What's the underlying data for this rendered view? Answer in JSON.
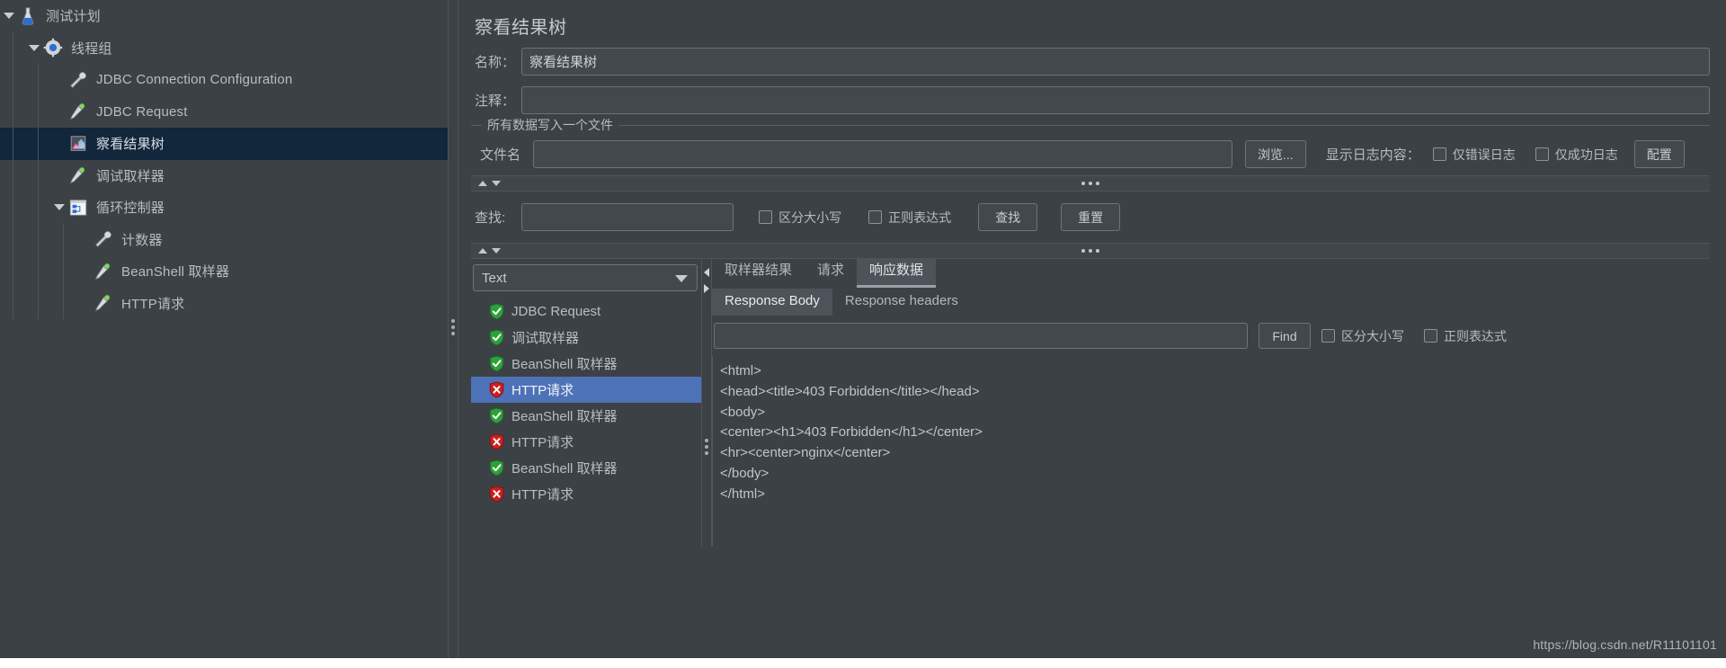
{
  "tree": {
    "items": [
      {
        "label": "测试计划",
        "icon": "flask-icon",
        "depth": 0,
        "twisty": "down",
        "selected": false
      },
      {
        "label": "线程组",
        "icon": "gear-icon",
        "depth": 1,
        "twisty": "down",
        "selected": false
      },
      {
        "label": "JDBC Connection Configuration",
        "icon": "tools-icon",
        "depth": 2,
        "twisty": "none",
        "selected": false
      },
      {
        "label": "JDBC Request",
        "icon": "pipette-icon",
        "depth": 2,
        "twisty": "none",
        "selected": false
      },
      {
        "label": "察看结果树",
        "icon": "chart-icon",
        "depth": 2,
        "twisty": "none",
        "selected": true
      },
      {
        "label": "调试取样器",
        "icon": "pipette-icon",
        "depth": 2,
        "twisty": "none",
        "selected": false
      },
      {
        "label": "循环控制器",
        "icon": "controller-icon",
        "depth": 2,
        "twisty": "down",
        "selected": false
      },
      {
        "label": "计数器",
        "icon": "tools-icon",
        "depth": 3,
        "twisty": "none",
        "selected": false
      },
      {
        "label": "BeanShell 取样器",
        "icon": "pipette-icon",
        "depth": 3,
        "twisty": "none",
        "selected": false
      },
      {
        "label": "HTTP请求",
        "icon": "pipette-icon",
        "depth": 3,
        "twisty": "none",
        "selected": false
      }
    ]
  },
  "panel": {
    "title": "察看结果树",
    "name_label": "名称：",
    "name_value": "察看结果树",
    "comment_label": "注释：",
    "comment_value": "",
    "comment_placeholder": "",
    "group_legend": "所有数据写入一个文件",
    "filename_label": "文件名",
    "filename_value": "",
    "browse_button": "浏览...",
    "log_display_label": "显示日志内容：",
    "errors_only": "仅错误日志",
    "success_only": "仅成功日志",
    "configure_button": "配置"
  },
  "search": {
    "label": "查找:",
    "value": "",
    "case_sensitive": "区分大小写",
    "regex": "正则表达式",
    "find_button": "查找",
    "reset_button": "重置"
  },
  "results": {
    "renderer_selected": "Text",
    "rows": [
      {
        "label": "JDBC Request",
        "status": "success",
        "selected": false
      },
      {
        "label": "调试取样器",
        "status": "success",
        "selected": false
      },
      {
        "label": "BeanShell 取样器",
        "status": "success",
        "selected": false
      },
      {
        "label": "HTTP请求",
        "status": "error",
        "selected": true
      },
      {
        "label": "BeanShell 取样器",
        "status": "success",
        "selected": false
      },
      {
        "label": "HTTP请求",
        "status": "error",
        "selected": false
      },
      {
        "label": "BeanShell 取样器",
        "status": "success",
        "selected": false
      },
      {
        "label": "HTTP请求",
        "status": "error",
        "selected": false
      }
    ]
  },
  "detail": {
    "tabs": [
      {
        "label": "取样器结果",
        "active": false
      },
      {
        "label": "请求",
        "active": false
      },
      {
        "label": "响应数据",
        "active": true
      }
    ],
    "subtabs": [
      {
        "label": "Response Body",
        "active": true
      },
      {
        "label": "Response headers",
        "active": false
      }
    ],
    "find": {
      "value": "",
      "find_button": "Find",
      "case_sensitive": "区分大小写",
      "regex": "正则表达式"
    },
    "response_body": [
      "<html>",
      "<head><title>403 Forbidden</title></head>",
      "<body>",
      "<center><h1>403 Forbidden</h1></center>",
      "<hr><center>nginx</center>",
      "</body>",
      "</html>"
    ]
  },
  "watermark": "https://blog.csdn.net/R11101101",
  "colors": {
    "background": "#3c4146",
    "tree_selected": "#12263c",
    "list_selected": "#4e72b8",
    "success_green": "#2fa03a",
    "error_red": "#cc1f1f",
    "text": "#b8bcc0"
  }
}
